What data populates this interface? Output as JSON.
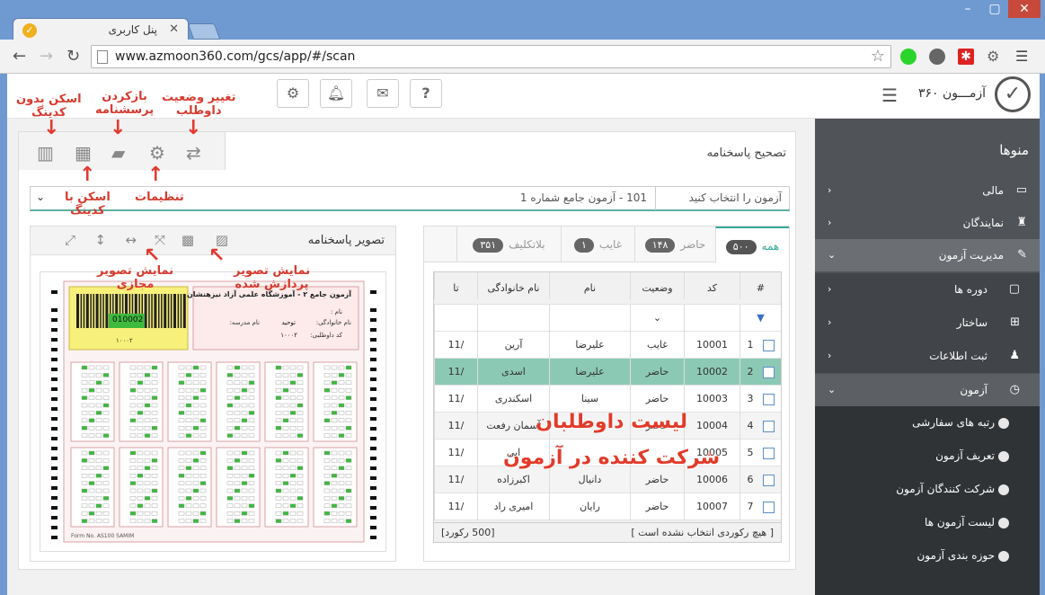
{
  "browser": {
    "tab_title": "پنل کاربری",
    "url": "www.azmoon360.com/gcs/app/#/scan",
    "window_controls": [
      "–",
      "▢",
      "✕"
    ]
  },
  "header": {
    "brand": "آزمـــون ۳۶۰",
    "buttons": [
      "settings-icon",
      "bell-icon",
      "mail-icon",
      "help-icon"
    ],
    "help_label": "?"
  },
  "sidebar": {
    "title": "منوها",
    "items": [
      {
        "label": "مالی",
        "icon": "card-icon"
      },
      {
        "label": "نمایندگان",
        "icon": "people-icon"
      },
      {
        "label": "مدیریت آزمون",
        "icon": "edit-icon",
        "active": true
      },
      {
        "label": "دوره ها",
        "icon": "folder-icon",
        "sub": true
      },
      {
        "label": "ساختار",
        "icon": "sitemap-icon",
        "sub": true
      },
      {
        "label": "ثبت اطلاعات",
        "icon": "user-add-icon",
        "sub": true
      },
      {
        "label": "آزمون",
        "icon": "clock-icon",
        "sub": true,
        "open": true
      }
    ],
    "subitems": [
      "رتبه های سفارشی",
      "تعریف آزمون",
      "شرکت کنندگان آزمون",
      "لیست آزمون ها",
      "حوزه بندی آزمون"
    ]
  },
  "panel": {
    "title": "تصحیح پاسخنامه",
    "exam_placeholder": "آزمون را انتخاب کنید",
    "exam_value": "101 - آزمون جامع شماره 1",
    "image_title": "تصویر پاسخنامه",
    "sheet": {
      "title": "آزمون جامع ۲ - آموزشگاه علمی آزاد نیزهنشان",
      "barcode": "010002",
      "code_small": "۱۰۰۰۲",
      "name_label": "نام :",
      "family_label": "نام خانوادگی:",
      "family_value": "توحید",
      "school_label": "نام مدرسه:",
      "code_label": "کد داوطلبی:",
      "code_value": "۱۰۰۰۲",
      "form_no": "Form No. AS100 SAMIM"
    }
  },
  "tabs": [
    {
      "label": "همه",
      "count": "۵۰۰",
      "active": true
    },
    {
      "label": "حاضر",
      "count": "۱۴۸"
    },
    {
      "label": "غایب",
      "count": "۱"
    },
    {
      "label": "بلاتکلیف",
      "count": "۳۵۱"
    }
  ],
  "table": {
    "headers": [
      "#",
      "کد",
      "وضعیت",
      "نام",
      "نام خانوادگی",
      "تا"
    ],
    "rows": [
      [
        "1",
        "10001",
        "غایب",
        "علیرضا",
        "آرین",
        "/11"
      ],
      [
        "2",
        "10002",
        "حاضر",
        "علیرضا",
        "اسدی",
        "/11"
      ],
      [
        "3",
        "10003",
        "حاضر",
        "سینا",
        "اسکندری",
        "/11"
      ],
      [
        "4",
        "10004",
        "حاضر",
        "",
        "آسمان رفعت",
        "/11"
      ],
      [
        "5",
        "10005",
        "",
        "",
        "ابی",
        "/11"
      ],
      [
        "6",
        "10006",
        "حاضر",
        "دانیال",
        "اکبرزاده",
        "/11"
      ],
      [
        "7",
        "10007",
        "حاضر",
        "رایان",
        "امیری راد",
        "/11"
      ]
    ],
    "footer_selected": "[ هیچ رکوردی انتخاب نشده است ]",
    "footer_count": "[500 رکورد]"
  },
  "annotations": {
    "scan_no_coding": "اسکن بدون\nکدینگ",
    "reload_sheet": "بازکردن\nپرسشنامه",
    "change_status": "تغییر وضعیت\nداوطلب",
    "scan_with_coding": "اسکن با\nکدینگ",
    "settings": "تنظیمات",
    "virtual_image": "نمایش تصویر\nمجازی",
    "processed_image": "نمایش تصویر\nپردازش شده",
    "candidates_list": "لیست داوطلبان\nشرکت کننده در آزمون"
  }
}
